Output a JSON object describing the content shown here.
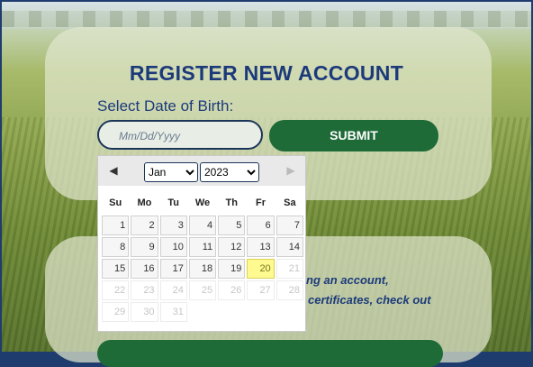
{
  "form": {
    "title": "REGISTER NEW ACCOUNT",
    "dob_label": "Select Date of Birth:",
    "dob_placeholder": "Mm/Dd/Yyyy",
    "submit_label": "SUBMIT"
  },
  "info_text": {
    "line1": "ng an account,",
    "line2": "certificates, check out"
  },
  "datepicker": {
    "selected_month": "Jan",
    "selected_year": "2023",
    "weekdays": [
      "Su",
      "Mo",
      "Tu",
      "We",
      "Th",
      "Fr",
      "Sa"
    ],
    "today": "20",
    "weeks": [
      [
        "1",
        "2",
        "3",
        "4",
        "5",
        "6",
        "7"
      ],
      [
        "8",
        "9",
        "10",
        "11",
        "12",
        "13",
        "14"
      ],
      [
        "15",
        "16",
        "17",
        "18",
        "19",
        "20",
        "21"
      ],
      [
        "22",
        "23",
        "24",
        "25",
        "26",
        "27",
        "28"
      ],
      [
        "29",
        "30",
        "31",
        "",
        "",
        "",
        ""
      ]
    ],
    "icons": {
      "prev": "chevron-left-icon",
      "next": "chevron-right-icon"
    }
  },
  "colors": {
    "title": "#1c3a7a",
    "button_green": "#1e6b38",
    "today_highlight": "#fffa90",
    "border_navy": "#1b3559"
  }
}
